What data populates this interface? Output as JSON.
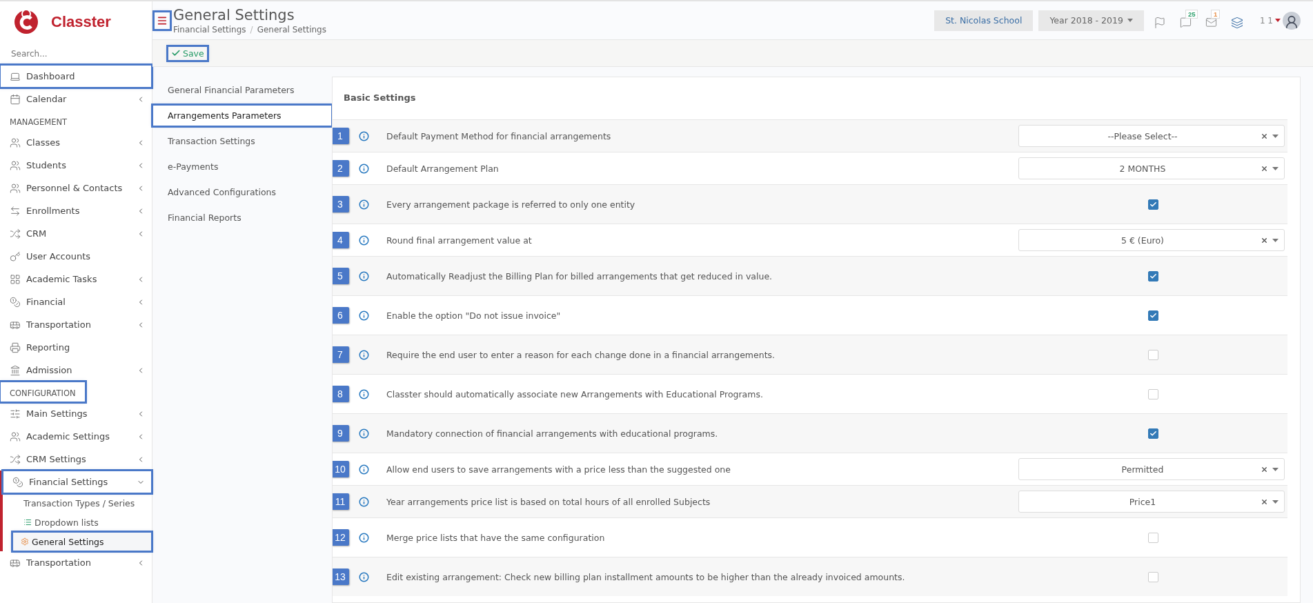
{
  "sidebar": {
    "logo_text": "Classter",
    "search_placeholder": "Search...",
    "items": [
      {
        "kind": "link",
        "label": "Dashboard",
        "expandable": false,
        "highlighted": true
      },
      {
        "kind": "link",
        "label": "Calendar",
        "expandable": true,
        "highlighted": false
      },
      {
        "kind": "heading",
        "label": "MANAGEMENT",
        "highlighted": false
      },
      {
        "kind": "link",
        "label": "Classes",
        "expandable": true,
        "highlighted": false
      },
      {
        "kind": "link",
        "label": "Students",
        "expandable": true,
        "highlighted": false
      },
      {
        "kind": "link",
        "label": "Personnel & Contacts",
        "expandable": true,
        "highlighted": false
      },
      {
        "kind": "link",
        "label": "Enrollments",
        "expandable": true,
        "highlighted": false
      },
      {
        "kind": "link",
        "label": "CRM",
        "expandable": true,
        "highlighted": false
      },
      {
        "kind": "link",
        "label": "User Accounts",
        "expandable": false,
        "highlighted": false
      },
      {
        "kind": "link",
        "label": "Academic Tasks",
        "expandable": true,
        "highlighted": false
      },
      {
        "kind": "link",
        "label": "Financial",
        "expandable": true,
        "highlighted": false
      },
      {
        "kind": "link",
        "label": "Transportation",
        "expandable": true,
        "highlighted": false
      },
      {
        "kind": "link",
        "label": "Reporting",
        "expandable": false,
        "highlighted": false
      },
      {
        "kind": "link",
        "label": "Admission",
        "expandable": true,
        "highlighted": false
      },
      {
        "kind": "heading",
        "label": "CONFIGURATION",
        "highlighted": true
      },
      {
        "kind": "link",
        "label": "Main Settings",
        "expandable": true,
        "highlighted": false
      },
      {
        "kind": "link",
        "label": "Academic Settings",
        "expandable": true,
        "highlighted": false
      },
      {
        "kind": "link",
        "label": "CRM Settings",
        "expandable": true,
        "highlighted": false
      },
      {
        "kind": "link",
        "label": "Financial Settings",
        "expandable": true,
        "expanded": true,
        "highlighted": true,
        "children": [
          {
            "label": "Transaction Types / Series",
            "selected": false,
            "highlighted": false
          },
          {
            "label": "Dropdown lists",
            "selected": false,
            "highlighted": false
          },
          {
            "label": "General Settings",
            "selected": true,
            "highlighted": true
          }
        ]
      },
      {
        "kind": "link",
        "label": "Transportation",
        "expandable": true,
        "highlighted": false
      }
    ]
  },
  "header": {
    "menu_highlighted": true,
    "title": "General Settings",
    "breadcrumb": [
      "Financial Settings",
      "General Settings"
    ],
    "breadcrumb_separator": "/",
    "school": "St. Nicolas School",
    "year": "Year 2018 - 2019",
    "notifications": "25",
    "messages": "1",
    "user": "1 1"
  },
  "toolbar": {
    "save_label": "Save",
    "save_highlighted": true
  },
  "tabs": [
    {
      "label": "General Financial Parameters",
      "selected": false,
      "highlighted": false
    },
    {
      "label": "Arrangements Parameters",
      "selected": true,
      "highlighted": true
    },
    {
      "label": "Transaction Settings",
      "selected": false,
      "highlighted": false
    },
    {
      "label": "e-Payments",
      "selected": false,
      "highlighted": false
    },
    {
      "label": "Advanced Configurations",
      "selected": false,
      "highlighted": false
    },
    {
      "label": "Financial Reports",
      "selected": false,
      "highlighted": false
    }
  ],
  "panel": {
    "title": "Basic Settings",
    "settings": [
      {
        "number": "1",
        "label": "Default Payment Method for financial arrangements",
        "kind": "select",
        "value": "--Please Select--"
      },
      {
        "number": "2",
        "label": "Default Arrangement Plan",
        "kind": "select",
        "value": "2 MONTHS"
      },
      {
        "number": "3",
        "label": "Every arrangement package is referred to only one entity",
        "kind": "checkbox",
        "checked": true
      },
      {
        "number": "4",
        "label": "Round final arrangement value at",
        "kind": "select",
        "value": "5 € (Euro)"
      },
      {
        "number": "5",
        "label": "Automatically Readjust the Billing Plan for billed arrangements that get reduced in value.",
        "kind": "checkbox",
        "checked": true
      },
      {
        "number": "6",
        "label": "Enable the option \"Do not issue invoice\"",
        "kind": "checkbox",
        "checked": true
      },
      {
        "number": "7",
        "label": "Require the end user to enter a reason for each change done in a financial arrangements.",
        "kind": "checkbox",
        "checked": false
      },
      {
        "number": "8",
        "label": "Classter should automatically associate new Arrangements with Educational Programs.",
        "kind": "checkbox",
        "checked": false
      },
      {
        "number": "9",
        "label": "Mandatory connection of financial arrangements with educational programs.",
        "kind": "checkbox",
        "checked": true
      },
      {
        "number": "10",
        "label": "Allow end users to save arrangements with a price less than the suggested one",
        "kind": "select",
        "value": "Permitted"
      },
      {
        "number": "11",
        "label": "Year arrangements price list is based on total hours of all enrolled Subjects",
        "kind": "select",
        "value": "Price1"
      },
      {
        "number": "12",
        "label": "Merge price lists that have the same configuration",
        "kind": "checkbox",
        "checked": false
      },
      {
        "number": "13",
        "label": "Edit existing arrangement: Check new billing plan installment amounts to be higher than the already invoiced amounts.",
        "kind": "checkbox",
        "checked": false
      }
    ]
  }
}
